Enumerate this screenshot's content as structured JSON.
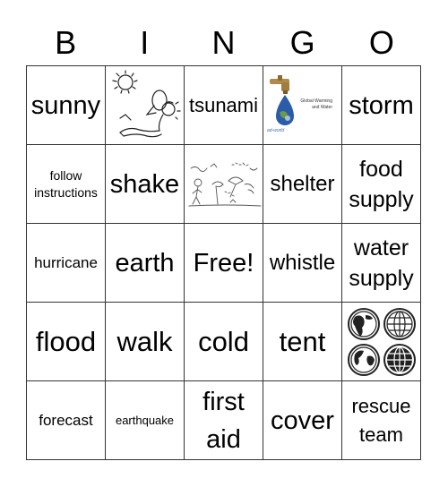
{
  "header": {
    "letters": [
      "B",
      "I",
      "N",
      "G",
      "O"
    ]
  },
  "cells": [
    {
      "type": "text",
      "text": "sunny"
    },
    {
      "type": "image",
      "icon": "sunburn-sunbathing-person-icon"
    },
    {
      "type": "text",
      "text": "tsunami"
    },
    {
      "type": "image",
      "icon": "global-warming-water-faucet-icon",
      "caption_line1": "Global Warming",
      "caption_line2": "and Water",
      "brand": "ad-world"
    },
    {
      "type": "text",
      "text": "storm"
    },
    {
      "type": "text",
      "text_line1": "follow",
      "text_line2": "instructions"
    },
    {
      "type": "text",
      "text": "shake"
    },
    {
      "type": "image",
      "icon": "windy-storm-scene-icon"
    },
    {
      "type": "text",
      "text": "shelter"
    },
    {
      "type": "text",
      "text_line1": "food",
      "text_line2": "supply"
    },
    {
      "type": "text",
      "text": "hurricane"
    },
    {
      "type": "text",
      "text": "earth"
    },
    {
      "type": "free",
      "text": "Free!"
    },
    {
      "type": "text",
      "text": "whistle"
    },
    {
      "type": "text",
      "text_line1": "water",
      "text_line2": "supply"
    },
    {
      "type": "text",
      "text": "flood"
    },
    {
      "type": "text",
      "text": "walk"
    },
    {
      "type": "text",
      "text": "cold"
    },
    {
      "type": "text",
      "text": "tent"
    },
    {
      "type": "image",
      "icon": "four-globes-icon"
    },
    {
      "type": "text",
      "text": "forecast"
    },
    {
      "type": "text",
      "text": "earthquake"
    },
    {
      "type": "text",
      "text_line1": "first",
      "text_line2": "aid"
    },
    {
      "type": "text",
      "text": "cover"
    },
    {
      "type": "text",
      "text_line1": "rescue",
      "text_line2": "team"
    }
  ]
}
